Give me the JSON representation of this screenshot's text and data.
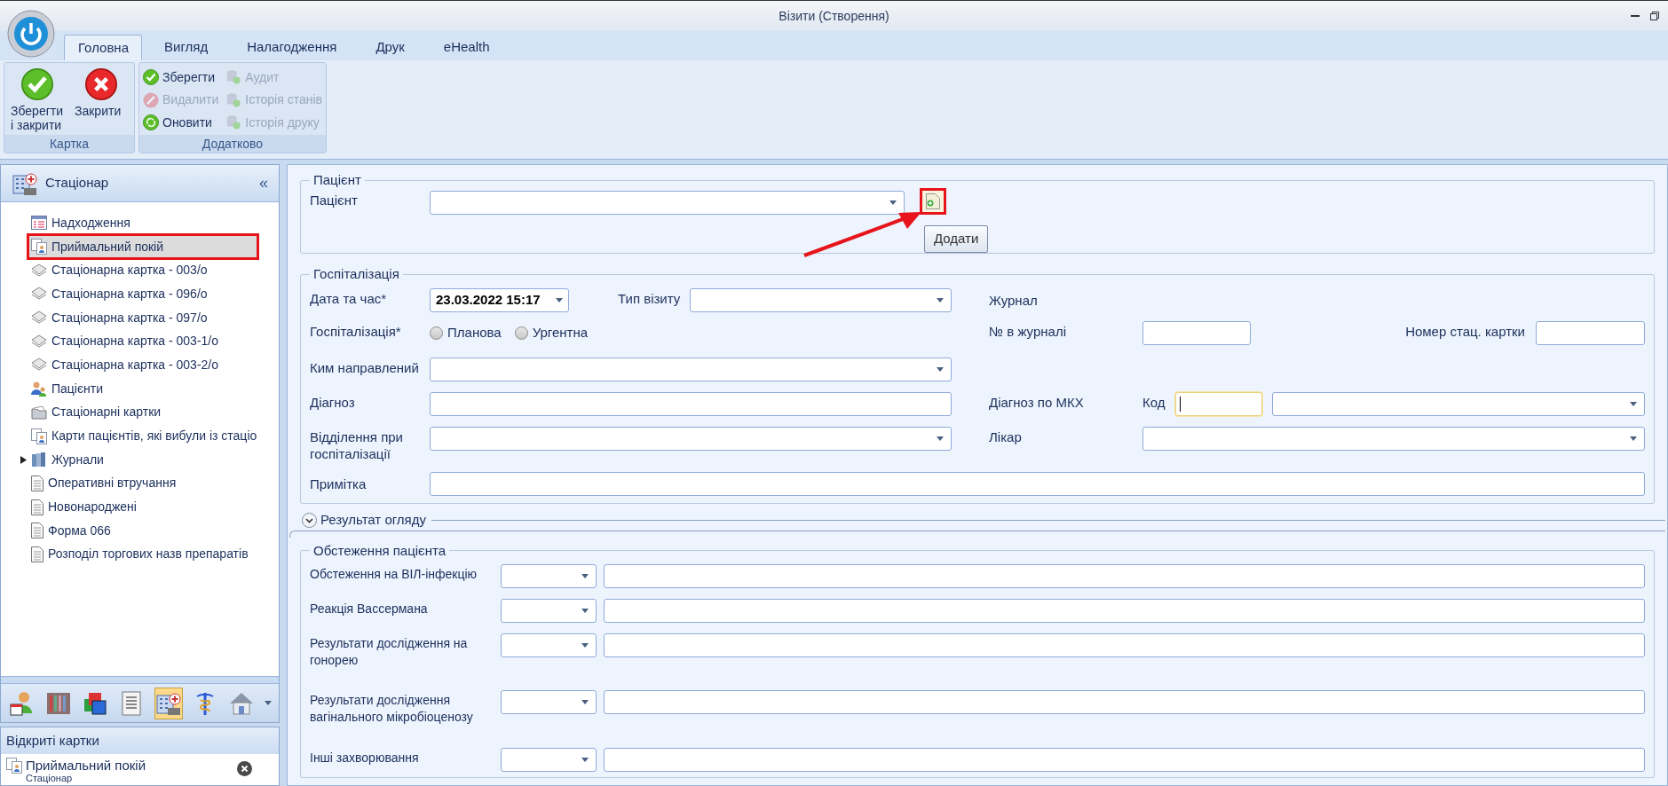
{
  "window": {
    "title": "Візити (Створення)"
  },
  "ribbon_tabs": [
    {
      "label": "Головна",
      "selected": true
    },
    {
      "label": "Вигляд",
      "selected": false
    },
    {
      "label": "Налагодження",
      "selected": false
    },
    {
      "label": "Друк",
      "selected": false
    },
    {
      "label": "eHealth",
      "selected": false
    }
  ],
  "ribbon_groups": [
    {
      "label": "Картка",
      "kind": "large",
      "buttons": [
        {
          "label": "Зберегти і закрити",
          "kind": "save",
          "disabled": false
        },
        {
          "label": "Закрити",
          "kind": "close",
          "disabled": false
        }
      ]
    },
    {
      "label": "Додатково",
      "kind": "small",
      "buttons": [
        {
          "label": "Зберегти",
          "kind": "save",
          "disabled": false
        },
        {
          "label": "Видалити",
          "kind": "delete",
          "disabled": true
        },
        {
          "label": "Оновити",
          "kind": "refresh",
          "disabled": false
        },
        {
          "label": "Аудит",
          "kind": "db",
          "disabled": true
        },
        {
          "label": "Історія станів",
          "kind": "db",
          "disabled": true
        },
        {
          "label": "Історія друку",
          "kind": "db",
          "disabled": true
        }
      ]
    }
  ],
  "sidebar": {
    "title": "Стаціонар",
    "collapse_glyph": "«",
    "items": [
      {
        "label": "Надходження",
        "kind": "list",
        "selected": false,
        "highlighted": false
      },
      {
        "label": "Приймальний покій",
        "kind": "card",
        "selected": true,
        "highlighted": true
      },
      {
        "label": "Стаціонарна картка - 003/о",
        "kind": "forms",
        "selected": false,
        "highlighted": false
      },
      {
        "label": "Стаціонарна картка - 096/о",
        "kind": "forms",
        "selected": false,
        "highlighted": false
      },
      {
        "label": "Стаціонарна картка - 097/о",
        "kind": "forms",
        "selected": false,
        "highlighted": false
      },
      {
        "label": "Стаціонарна картка - 003-1/о",
        "kind": "forms",
        "selected": false,
        "highlighted": false
      },
      {
        "label": "Стаціонарна картка - 003-2/о",
        "kind": "forms",
        "selected": false,
        "highlighted": false
      },
      {
        "label": "Пацієнти",
        "kind": "patients",
        "selected": false,
        "highlighted": false
      },
      {
        "label": "Стаціонарні картки",
        "kind": "folder",
        "selected": false,
        "highlighted": false
      },
      {
        "label": "Карти пацієнтів, які вибули із стаціо",
        "kind": "card",
        "selected": false,
        "highlighted": false
      },
      {
        "label": "Журнали",
        "kind": "journal",
        "selected": false,
        "highlighted": false,
        "expanded": false
      },
      {
        "label": "Оперативні втручання",
        "kind": "doc",
        "selected": false,
        "highlighted": false
      },
      {
        "label": "Новонароджені",
        "kind": "doc",
        "selected": false,
        "highlighted": false
      },
      {
        "label": "Форма 066",
        "kind": "doc",
        "selected": false,
        "highlighted": false
      },
      {
        "label": "Розподіл торгових назв препаратів",
        "kind": "doc",
        "selected": false,
        "highlighted": false
      }
    ]
  },
  "navigator": [
    {
      "kind": "calendar",
      "selected": false
    },
    {
      "kind": "books",
      "selected": false
    },
    {
      "kind": "windows",
      "selected": false
    },
    {
      "kind": "list",
      "selected": false
    },
    {
      "kind": "hospital",
      "selected": true
    },
    {
      "kind": "caduceus",
      "selected": false
    },
    {
      "kind": "house",
      "selected": false
    }
  ],
  "open_cards": {
    "title": "Відкриті картки",
    "items": [
      {
        "title": "Приймальний покій",
        "subtitle": "Стаціонар"
      }
    ]
  },
  "patient_section": {
    "legend": "Пацієнт",
    "label": "Пацієнт",
    "add_highlighted": true,
    "tooltip": "Додати"
  },
  "hospitalization": {
    "legend": "Госпіталізація",
    "date_label": "Дата та час*",
    "date_value": "23.03.2022 15:17",
    "visit_type_label": "Тип візиту",
    "journal_label": "Журнал",
    "kind_label": "Госпіталізація*",
    "kind_options": [
      {
        "label": "Планова",
        "selected": false
      },
      {
        "label": "Ургентна",
        "selected": false
      }
    ],
    "journal_number_label": "№ в журналі",
    "card_number_label": "Номер стац. картки",
    "referred_by_label": "Ким направлений",
    "diagnosis_label": "Діагноз",
    "icd_label": "Діагноз по МКХ",
    "code_label": "Код",
    "code_focused": true,
    "department_label": "Відділення при госпіталізації",
    "doctor_label": "Лікар",
    "note_label": "Примітка"
  },
  "exam_result": {
    "label": "Результат огляду",
    "expanded": false
  },
  "patient_exams": {
    "legend": "Обстеження пацієнта",
    "rows": [
      {
        "label": "Обстеження на ВІЛ-інфекцію"
      },
      {
        "label": "Реакція Вассермана"
      },
      {
        "label": "Результати дослідження на гонорею"
      },
      {
        "label": "Результати дослідження вагінального мікробіоценозу"
      },
      {
        "label": "Інші захворювання"
      }
    ]
  }
}
